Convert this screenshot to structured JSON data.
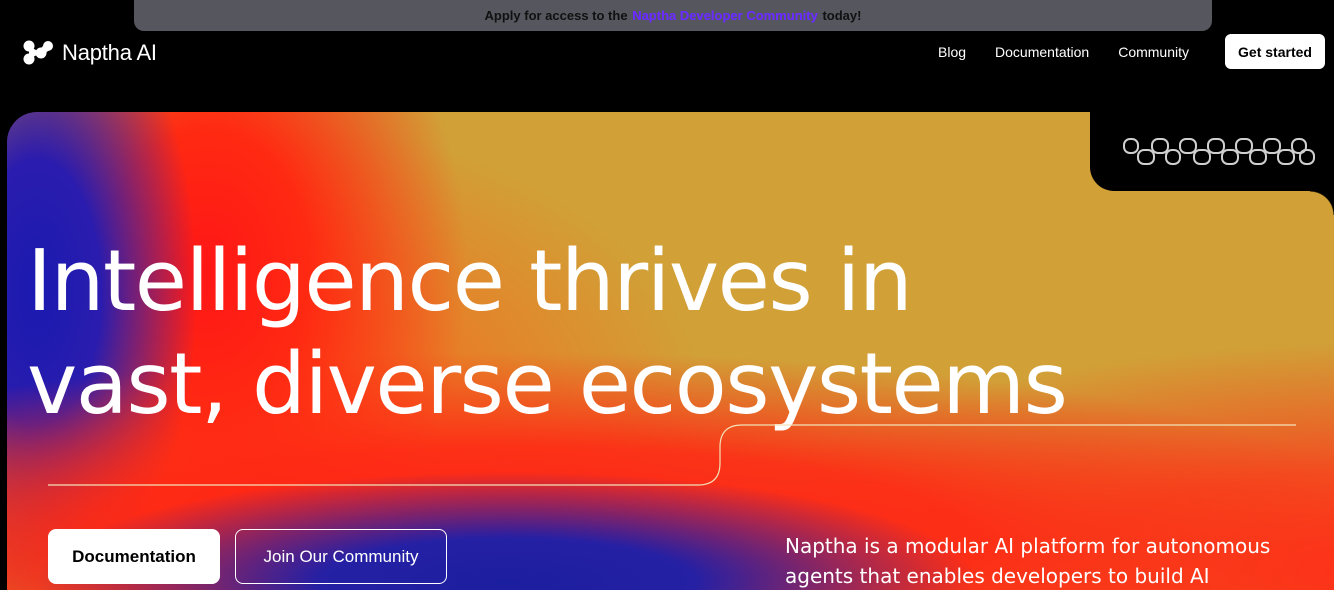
{
  "banner": {
    "prefix": "Apply for access to the",
    "link": "Naptha Developer Community",
    "suffix": "today!"
  },
  "brand": {
    "name": "Naptha AI",
    "logo_icon": "naptha-logo-icon"
  },
  "nav": {
    "items": [
      {
        "label": "Blog"
      },
      {
        "label": "Documentation"
      },
      {
        "label": "Community"
      }
    ],
    "cta_label": "Get started"
  },
  "hero": {
    "headline_line1": "Intelligence thrives in",
    "headline_line2": "vast, diverse ecosystems",
    "primary_button": "Documentation",
    "secondary_button": "Join Our Community",
    "description": "Naptha is a modular AI platform for autonomous agents that enables developers to build AI"
  },
  "colors": {
    "background": "#000000",
    "banner": "#55565e",
    "banner_link": "#6a2cff",
    "hero_gold": "#d1a037",
    "hero_red": "#ff1f1a",
    "hero_blue": "#1c1ea0"
  }
}
